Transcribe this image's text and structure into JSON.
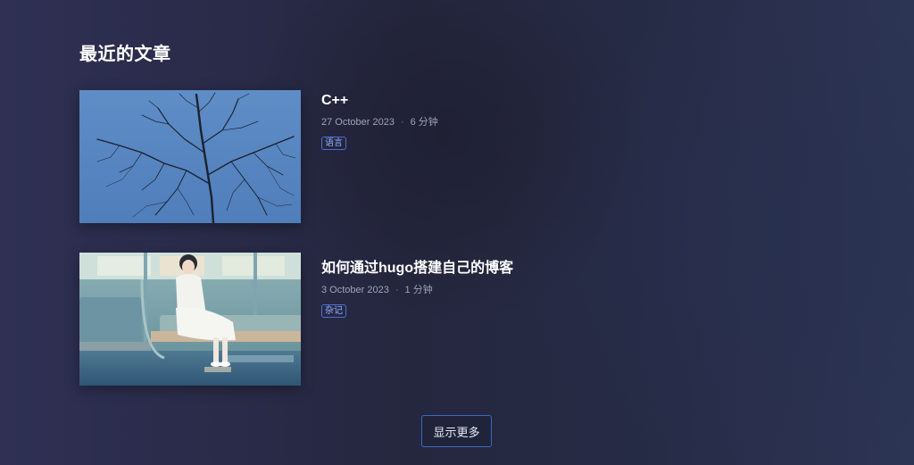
{
  "section": {
    "title": "最近的文章"
  },
  "posts": [
    {
      "title": "C++",
      "date": "27 October 2023",
      "separator": "·",
      "read_time": "6 分钟",
      "tag": "语言",
      "thumbnail_icon": "bare-tree-sky-image"
    },
    {
      "title": "如何通过hugo搭建自己的博客",
      "date": "3 October 2023",
      "separator": "·",
      "read_time": "1 分钟",
      "tag": "杂记",
      "thumbnail_icon": "girl-on-train-image"
    }
  ],
  "more_button": {
    "label": "显示更多"
  },
  "colors": {
    "accent": "#3f67c2",
    "tag_text": "#8fb0ff",
    "meta_text": "#9ea3b8"
  }
}
